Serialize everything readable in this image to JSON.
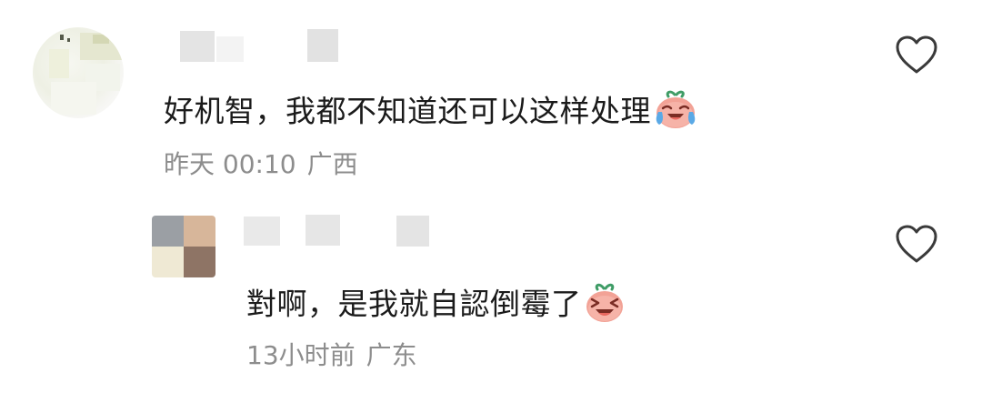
{
  "comments": [
    {
      "text": "好机智，我都不知道还可以这样处理",
      "emoji": "cry-laugh-emoji",
      "time": "昨天 00:10",
      "location": "广西",
      "liked": false
    }
  ],
  "reply": {
    "text": "對啊，是我就自認倒霉了",
    "emoji": "grin-emoji",
    "time": "13小时前",
    "location": "广东",
    "liked": false
  },
  "icons": {
    "like": "heart-outline-icon"
  },
  "colors": {
    "text": "#1b1b1b",
    "meta": "#8d8d8d",
    "icon": "#3a3a3a",
    "emoji_face": "#f2a296",
    "emoji_leaf": "#3f9c66"
  }
}
